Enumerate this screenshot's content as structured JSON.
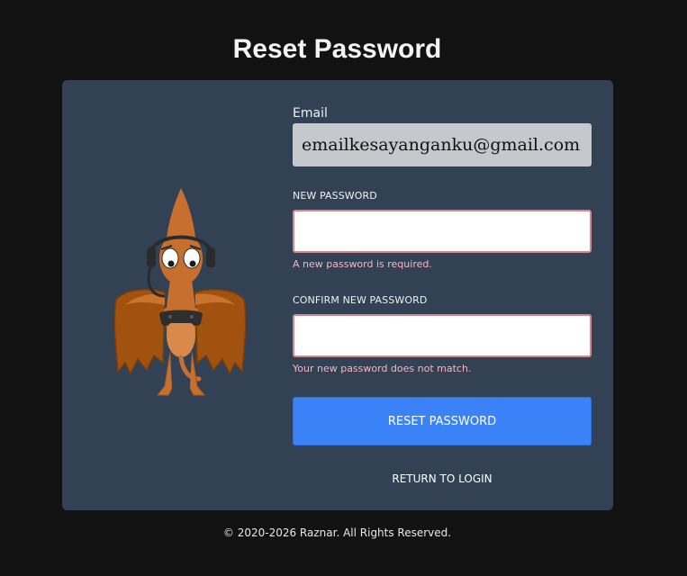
{
  "page": {
    "title": "Reset Password"
  },
  "form": {
    "email_label": "Email",
    "email_value": "emailkesayanganku@gmail.com",
    "new_password_label": "NEW PASSWORD",
    "new_password_value": "",
    "new_password_error": "A new password is required.",
    "confirm_password_label": "CONFIRM NEW PASSWORD",
    "confirm_password_value": "",
    "confirm_password_error": "Your new password does not match.",
    "reset_button_label": "RESET PASSWORD",
    "return_link_label": "RETURN TO LOGIN"
  },
  "footer": {
    "copyright": "© 2020-2026 Raznar.  All Rights Reserved."
  },
  "mascot": {
    "icon": "pterodactyl-gamer-mascot"
  },
  "colors": {
    "background": "#121212",
    "card": "#334155",
    "primary_button": "#3b82f6",
    "error_border": "#d9868b",
    "error_text": "#f7b6bd",
    "email_field_bg": "#c5c8cd"
  }
}
